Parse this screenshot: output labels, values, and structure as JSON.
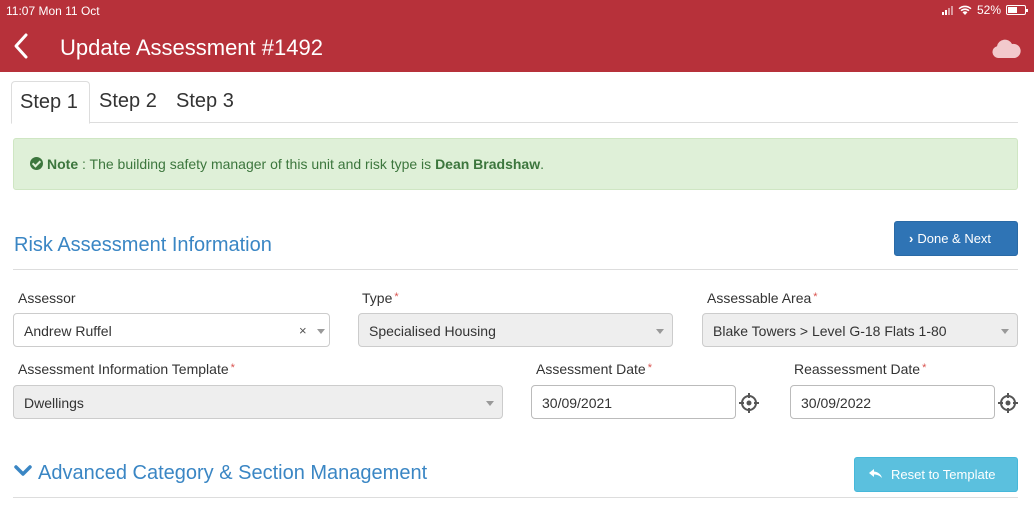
{
  "status": {
    "time": "11:07  Mon 11 Oct",
    "battery": "52%"
  },
  "nav": {
    "title": "Update Assessment #1492"
  },
  "tabs": [
    "Step 1",
    "Step 2",
    "Step 3"
  ],
  "note": {
    "label": "Note",
    "text": " : The building safety manager of this unit and risk type is ",
    "manager": "Dean Bradshaw",
    "end": "."
  },
  "section": {
    "title": "Risk Assessment Information",
    "done_label": "Done & Next"
  },
  "form": {
    "assessor": {
      "label": "Assessor",
      "value": "Andrew Ruffel",
      "clear": "×"
    },
    "type": {
      "label": "Type",
      "required": "*",
      "value": "Specialised Housing"
    },
    "area": {
      "label": "Assessable Area",
      "required": "*",
      "value": "Blake Towers > Level G-18 Flats 1-80"
    },
    "template": {
      "label": "Assessment Information Template",
      "required": "*",
      "value": "Dwellings"
    },
    "assessment_date": {
      "label": "Assessment Date",
      "required": "*",
      "value": "30/09/2021"
    },
    "reassessment_date": {
      "label": "Reassessment Date",
      "required": "*",
      "value": "30/09/2022"
    }
  },
  "advanced": {
    "title": "Advanced Category & Section Management",
    "reset_label": "Reset to Template"
  },
  "colors": {
    "brand": "#b7313a",
    "primary": "#2f74b5",
    "info": "#5bc0de",
    "success_bg": "#dff0d8"
  },
  "icons": [
    "back-chevron-icon",
    "cloud-icon",
    "check-circle-icon",
    "chevron-right-icon",
    "calendar-crosshair-icon",
    "chevron-down-icon",
    "reply-arrow-icon",
    "wifi-icon",
    "signal-icon",
    "battery-icon"
  ]
}
